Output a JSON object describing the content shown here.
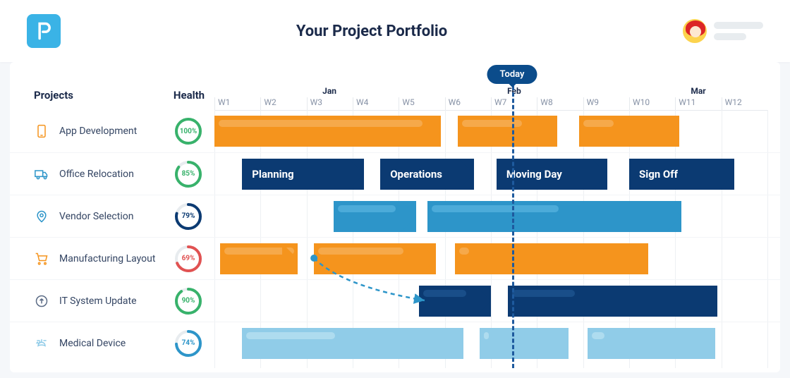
{
  "header": {
    "title": "Your Project Portfolio"
  },
  "today_label": "Today",
  "columns": {
    "projects": "Projects",
    "health": "Health"
  },
  "months": [
    {
      "label": "Jan",
      "pos_pct": 20.8
    },
    {
      "label": "Feb",
      "pos_pct": 54.2
    },
    {
      "label": "Mar",
      "pos_pct": 87.5
    }
  ],
  "weeks": [
    "W1",
    "W2",
    "W3",
    "W4",
    "W5",
    "W6",
    "W7",
    "W8",
    "W9",
    "W10",
    "W11",
    "W12"
  ],
  "today_week": 6.4,
  "projects": [
    {
      "name": "App Development",
      "icon": "phone",
      "icon_color": "#f5941d",
      "health": {
        "value": 100,
        "color": "#38b26b"
      },
      "bars": [
        {
          "start": 0,
          "len": 41,
          "color": "orange",
          "label": "",
          "progress": 90
        },
        {
          "start": 44,
          "len": 18,
          "color": "orange",
          "label": "",
          "progress": 60
        },
        {
          "start": 66,
          "len": 18,
          "color": "orange",
          "label": "",
          "progress": 30
        }
      ]
    },
    {
      "name": "Office Relocation",
      "icon": "truck",
      "icon_color": "#2d95c9",
      "health": {
        "value": 85,
        "color": "#38b26b"
      },
      "bars": [
        {
          "start": 5,
          "len": 22,
          "color": "navy",
          "label": "Planning",
          "progress": 0
        },
        {
          "start": 30,
          "len": 17,
          "color": "navy",
          "label": "Operations",
          "progress": 0
        },
        {
          "start": 51,
          "len": 20,
          "color": "navy",
          "label": "Moving Day",
          "progress": 0
        },
        {
          "start": 75,
          "len": 19,
          "color": "navy",
          "label": "Sign Off",
          "progress": 0
        }
      ]
    },
    {
      "name": "Vendor Selection",
      "icon": "pin",
      "icon_color": "#2d95c9",
      "health": {
        "value": 79,
        "color": "#0b3a72"
      },
      "bars": [
        {
          "start": 21.5,
          "len": 15,
          "color": "blue",
          "label": "",
          "progress": 70
        },
        {
          "start": 38.5,
          "len": 46,
          "color": "blue",
          "label": "",
          "progress": 50
        }
      ]
    },
    {
      "name": "Manufacturing Layout",
      "icon": "cart",
      "icon_color": "#f5941d",
      "health": {
        "value": 69,
        "color": "#e15252"
      },
      "bars": [
        {
          "start": 1,
          "len": 14,
          "color": "orange",
          "label": "",
          "progress": 90
        },
        {
          "start": 18,
          "len": 22,
          "color": "orange",
          "label": "",
          "progress": 70
        },
        {
          "start": 43.5,
          "len": 35,
          "color": "orange",
          "label": "",
          "progress": 5
        }
      ]
    },
    {
      "name": "IT System Update",
      "icon": "upload",
      "icon_color": "#5b6b85",
      "health": {
        "value": 90,
        "color": "#38b26b"
      },
      "bars": [
        {
          "start": 37,
          "len": 13,
          "color": "navy",
          "label": "",
          "progress": 60
        },
        {
          "start": 53,
          "len": 38,
          "color": "navy",
          "label": "",
          "progress": 30
        }
      ]
    },
    {
      "name": "Medical Device",
      "icon": "heart",
      "icon_color": "#90cce8",
      "health": {
        "value": 74,
        "color": "#2d95c9"
      },
      "bars": [
        {
          "start": 5,
          "len": 40,
          "color": "sky",
          "label": "",
          "progress": 40
        },
        {
          "start": 48,
          "len": 16,
          "color": "sky",
          "label": "",
          "progress": 5
        },
        {
          "start": 67.5,
          "len": 23,
          "color": "sky",
          "label": "",
          "progress": 10
        }
      ]
    }
  ],
  "dependency": {
    "from_row": 3,
    "from_pct": 18,
    "to_row": 4,
    "to_pct": 38
  },
  "chart_data": {
    "type": "gantt",
    "title": "Your Project Portfolio",
    "x_unit": "week",
    "x_range": [
      1,
      12
    ],
    "today": 6.4,
    "month_markers": {
      "Jan": 3,
      "Feb": 7,
      "Mar": 11
    },
    "series": [
      {
        "name": "App Development",
        "health_pct": 100,
        "health_status": "green",
        "tasks": [
          {
            "start": 1,
            "end": 6
          },
          {
            "start": 6.3,
            "end": 8.7
          },
          {
            "start": 8.9,
            "end": 11.2
          }
        ]
      },
      {
        "name": "Office Relocation",
        "health_pct": 85,
        "health_status": "green",
        "tasks": [
          {
            "label": "Planning",
            "start": 1.6,
            "end": 4.5
          },
          {
            "label": "Operations",
            "start": 4.6,
            "end": 6.9
          },
          {
            "label": "Moving Day",
            "start": 7.1,
            "end": 9.8
          },
          {
            "label": "Sign Off",
            "start": 10.0,
            "end": 12.5
          }
        ]
      },
      {
        "name": "Vendor Selection",
        "health_pct": 79,
        "health_status": "navy",
        "tasks": [
          {
            "start": 3.6,
            "end": 5.6
          },
          {
            "start": 5.6,
            "end": 11.4
          }
        ]
      },
      {
        "name": "Manufacturing Layout",
        "health_pct": 69,
        "health_status": "red",
        "tasks": [
          {
            "start": 1.1,
            "end": 3.1
          },
          {
            "start": 3.2,
            "end": 6.1
          },
          {
            "start": 6.2,
            "end": 10.6
          }
        ]
      },
      {
        "name": "IT System Update",
        "health_pct": 90,
        "health_status": "green",
        "tasks": [
          {
            "start": 5.4,
            "end": 7.2
          },
          {
            "start": 7.4,
            "end": 12.2
          }
        ]
      },
      {
        "name": "Medical Device",
        "health_pct": 74,
        "health_status": "blue",
        "tasks": [
          {
            "start": 1.6,
            "end": 6.6
          },
          {
            "start": 6.8,
            "end": 8.9
          },
          {
            "start": 9.1,
            "end": 12.0
          }
        ]
      }
    ],
    "dependencies": [
      {
        "from": "Manufacturing Layout",
        "from_task": 0,
        "to": "IT System Update",
        "to_task": 0
      }
    ]
  }
}
